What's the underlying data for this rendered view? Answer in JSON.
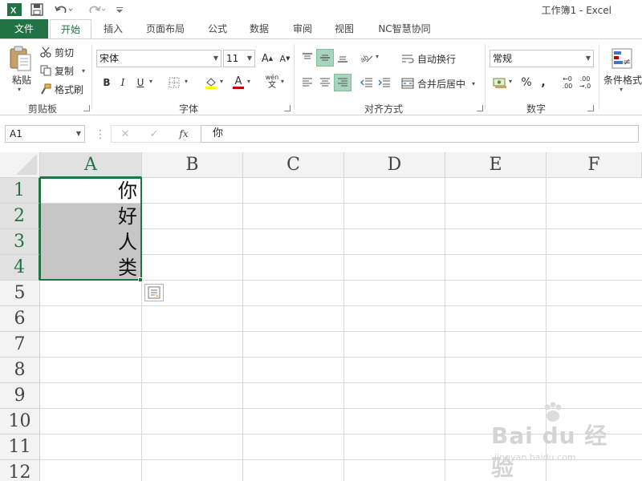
{
  "window": {
    "title": "工作簿1 - Excel"
  },
  "quick_access": {
    "icons": [
      "excel-logo-icon",
      "save-icon",
      "undo-icon",
      "redo-icon",
      "customize-icon"
    ],
    "excel_logo": "X"
  },
  "tabs": [
    {
      "label": "文件",
      "active": false
    },
    {
      "label": "开始",
      "active": true
    },
    {
      "label": "插入",
      "active": false
    },
    {
      "label": "页面布局",
      "active": false
    },
    {
      "label": "公式",
      "active": false
    },
    {
      "label": "数据",
      "active": false
    },
    {
      "label": "审阅",
      "active": false
    },
    {
      "label": "视图",
      "active": false
    },
    {
      "label": "NC智慧协同",
      "active": false
    }
  ],
  "ribbon": {
    "clipboard": {
      "paste": "粘贴",
      "cut": "剪切",
      "copy": "复制",
      "format_painter": "格式刷",
      "label": "剪贴板"
    },
    "font": {
      "font_name": "宋体",
      "font_size": "11",
      "bold": "B",
      "italic": "I",
      "underline": "U",
      "grow": "A",
      "shrink": "A",
      "font_color_glyph": "A",
      "phonetic_top": "wén",
      "phonetic_bottom": "文",
      "label": "字体"
    },
    "alignment": {
      "wrap_text": "自动换行",
      "merge_center": "合并后居中",
      "label": "对齐方式"
    },
    "number": {
      "format": "常规",
      "percent": "%",
      "comma": ",",
      "increase_decimal_top": "←0",
      "increase_decimal_bottom": ".00",
      "decrease_decimal_top": ".00",
      "decrease_decimal_bottom": "→.0",
      "label": "数字"
    },
    "styles": {
      "conditional_format": "条件格式"
    }
  },
  "formula_bar": {
    "name_box": "A1",
    "cancel": "✕",
    "enter": "✓",
    "fx": "fx",
    "value": "你"
  },
  "sheet": {
    "columns": [
      "A",
      "B",
      "C",
      "D",
      "E",
      "F"
    ],
    "rows": [
      "1",
      "2",
      "3",
      "4",
      "5",
      "6",
      "7",
      "8",
      "9",
      "10",
      "11",
      "12"
    ],
    "cells": [
      {
        "ref": "A1",
        "value": "你"
      },
      {
        "ref": "A2",
        "value": "好"
      },
      {
        "ref": "A3",
        "value": "人"
      },
      {
        "ref": "A4",
        "value": "类"
      }
    ]
  },
  "watermark": {
    "main": "Bai du 经验",
    "sub": "jingyan.baidu.com"
  },
  "colors": {
    "accent": "#217346",
    "selection_fill": "#c6c6c6",
    "align_active": "#a6d5bc"
  }
}
